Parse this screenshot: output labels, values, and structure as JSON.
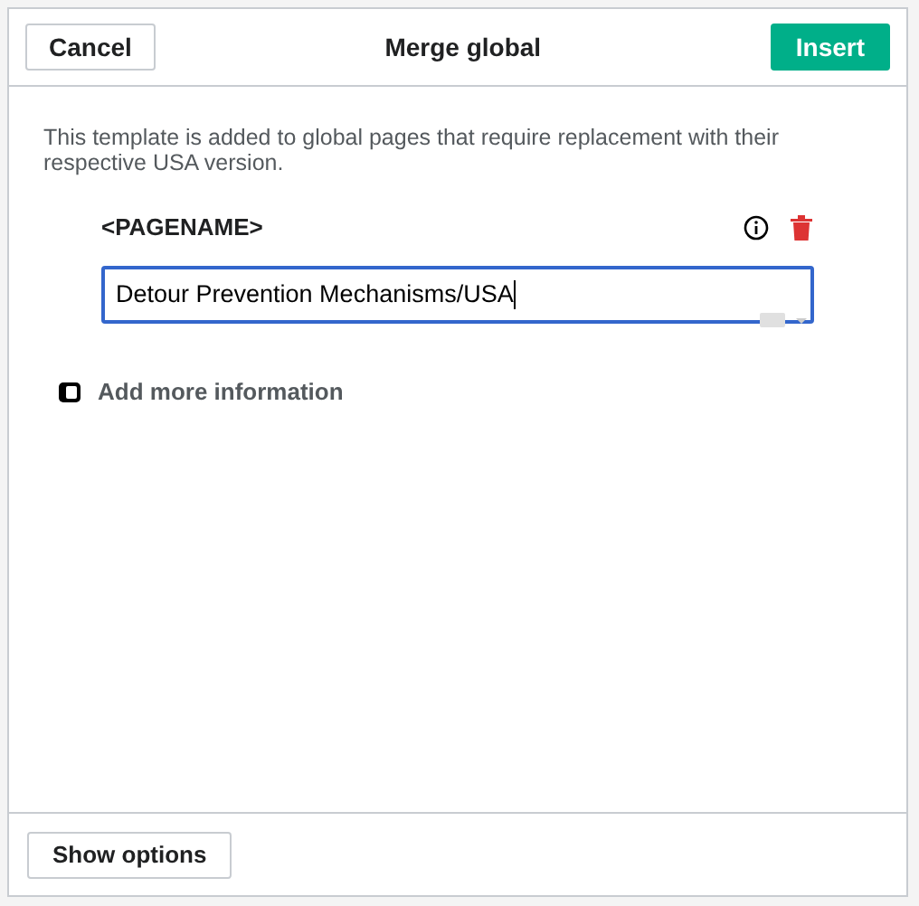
{
  "dialog": {
    "title": "Merge global",
    "cancel_button": "Cancel",
    "insert_button": "Insert",
    "description": "This template is added to global pages that require replacement with their respective USA version.",
    "parameter": {
      "name": "<PAGENAME>",
      "value": "Detour Prevention Mechanisms/USA"
    },
    "add_more_link": "Add more information",
    "footer_button": "Show options"
  }
}
